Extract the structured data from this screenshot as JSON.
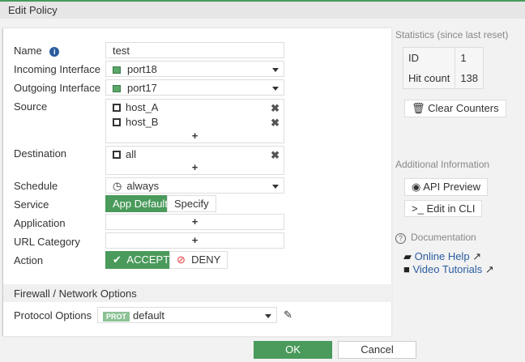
{
  "header": {
    "title": "Edit Policy"
  },
  "form": {
    "name_label": "Name",
    "name_value": "test",
    "incoming_label": "Incoming Interface",
    "incoming_value": "port18",
    "outgoing_label": "Outgoing Interface",
    "outgoing_value": "port17",
    "source_label": "Source",
    "source_items": [
      "host_A",
      "host_B"
    ],
    "destination_label": "Destination",
    "destination_items": [
      "all"
    ],
    "schedule_label": "Schedule",
    "schedule_value": "always",
    "service_label": "Service",
    "service_options": [
      "App Default",
      "Specify"
    ],
    "application_label": "Application",
    "url_label": "URL Category",
    "action_label": "Action",
    "action_options": [
      "ACCEPT",
      "DENY"
    ],
    "plus": "+",
    "remove": "✖",
    "section_title": "Firewall / Network Options",
    "protocol_label": "Protocol Options",
    "protocol_badge": "PROT",
    "protocol_value": "default"
  },
  "sidebar": {
    "stats_title": "Statistics (since last reset)",
    "stats": [
      {
        "k": "ID",
        "v": "1"
      },
      {
        "k": "Hit count",
        "v": "138"
      }
    ],
    "clear_counters": "Clear Counters",
    "additional_title": "Additional Information",
    "api_preview": "API Preview",
    "edit_cli": "Edit in CLI",
    "documentation": "Documentation",
    "online_help": "Online Help",
    "video_tutorials": "Video Tutorials"
  },
  "footer": {
    "ok": "OK",
    "cancel": "Cancel"
  },
  "colors": {
    "accent": "#4a9a5b",
    "link": "#2a5d9f"
  }
}
